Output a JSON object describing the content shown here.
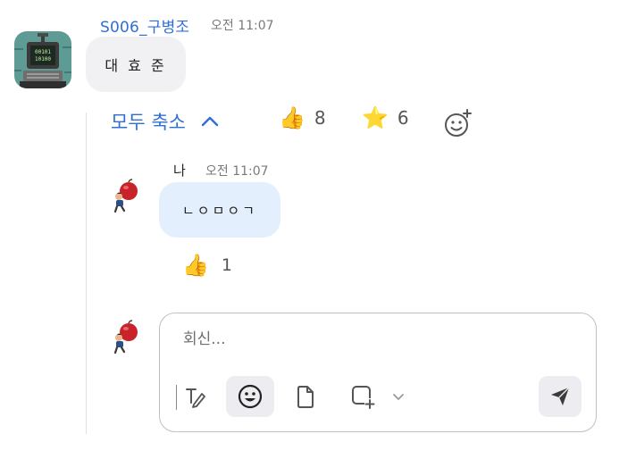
{
  "original_message": {
    "sender": "S006_구병조",
    "time": "오전 11:07",
    "text": "대 효 준"
  },
  "reaction_bar": {
    "collapse_label": "모두 축소",
    "reactions": [
      {
        "emoji": "👍",
        "count": "8"
      },
      {
        "emoji": "⭐",
        "count": "6"
      }
    ]
  },
  "reply": {
    "sender": "나",
    "time": "오전 11:07",
    "text": "ㄴㅇㅁㅇㄱ",
    "reaction": {
      "emoji": "👍",
      "count": "1"
    }
  },
  "composer": {
    "placeholder": "회신..."
  },
  "colors": {
    "accent": "#2f6fd4",
    "reply_bubble": "#e3effc",
    "message_bubble": "#f1f1f4"
  }
}
